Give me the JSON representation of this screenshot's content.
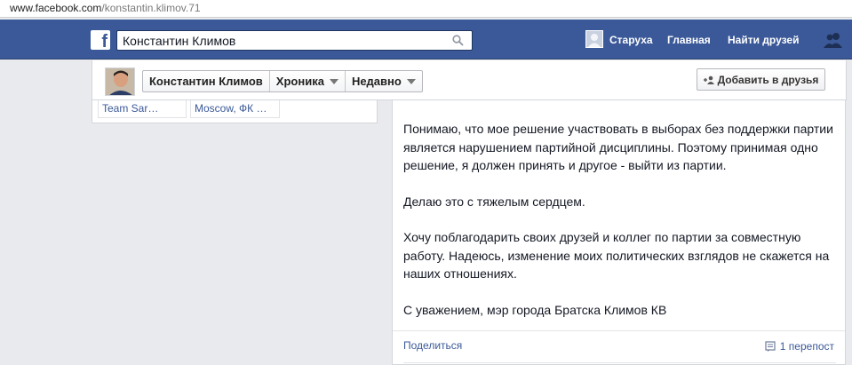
{
  "browser": {
    "url_host": "www.facebook.com",
    "url_path": "/konstantin.klimov.71"
  },
  "header": {
    "logo": "f",
    "search_value": "Константин Климов",
    "nav": {
      "profile": "Старуха",
      "home": "Главная",
      "find_friends": "Найти друзей"
    }
  },
  "profile_bar": {
    "name": "Константин Климов",
    "timeline": "Хроника",
    "recent": "Недавно",
    "add_friend": "Добавить в друзья"
  },
  "left_column": {
    "tags": [
      "Team Sar…",
      "Moscow, ФК …"
    ]
  },
  "post": {
    "paragraphs": [
      "Понимаю, что мое решение участвовать в выборах без поддержки партии является нарушением партийной дисциплины. Поэтому принимая одно решение, я должен принять и другое - выйти из партии.",
      "Делаю это с тяжелым сердцем.",
      "Хочу поблагодарить своих друзей и коллег по партии за совместную работу. Надеюсь, изменение моих политических взглядов не скажется на наших отношениях.",
      "С уважением, мэр города Братска Климов КВ"
    ],
    "share": "Поделиться",
    "reposts": "1 перепост"
  },
  "colors": {
    "brand": "#3b5998",
    "page_bg": "#e9eaed"
  }
}
